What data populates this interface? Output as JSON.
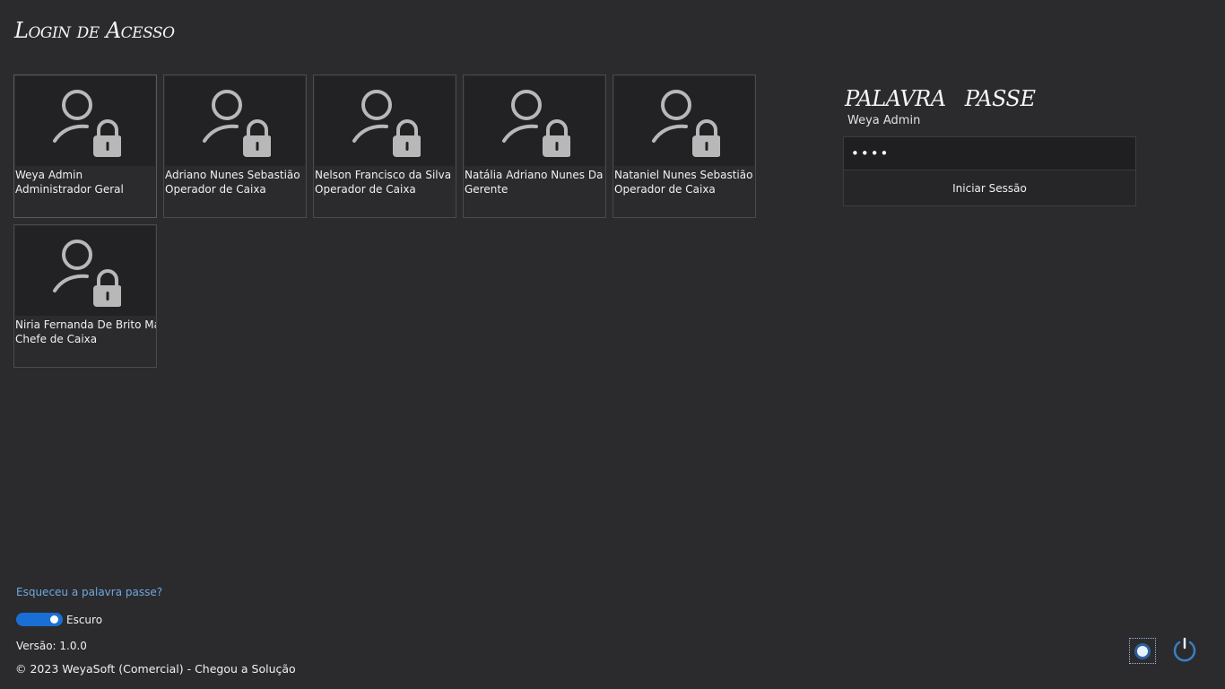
{
  "header": {
    "title": "Login de Acesso"
  },
  "users": [
    {
      "name": "Weya Admin",
      "role": "Administrador Geral"
    },
    {
      "name": "Adriano Nunes Sebastião",
      "role": "Operador de Caixa"
    },
    {
      "name": "Nelson Francisco da Silva",
      "role": "Operador de Caixa"
    },
    {
      "name": "Natália Adriano Nunes Da S",
      "role": "Gerente"
    },
    {
      "name": "Nataniel Nunes Sebastião",
      "role": "Operador de Caixa"
    },
    {
      "name": "Niria Fernanda De Brito Mat",
      "role": "Chefe de Caixa"
    }
  ],
  "login_panel": {
    "title": "PALAVRA PASSE",
    "selected_user": "Weya Admin",
    "password_value": "••••",
    "login_button": "Iniciar Sessão"
  },
  "footer": {
    "forgot_link": "Esqueceu a palavra passe?",
    "theme_label": "Escuro",
    "version": "Versão: 1.0.0",
    "copyright": "© 2023 WeyaSoft (Comercial) - Chegou a Solução"
  },
  "icons": {
    "user_lock": "user-lock-icon",
    "settings": "settings-icon",
    "power": "power-icon"
  },
  "colors": {
    "background": "#2b2b2e",
    "card_avatar_bg": "#222224",
    "link": "#6fa8dc",
    "toggle_on": "#1a6fd6",
    "power_accent": "#3a7fc4"
  }
}
